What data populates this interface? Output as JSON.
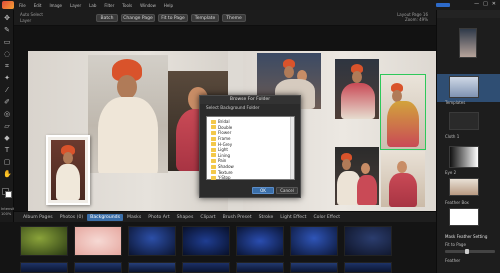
{
  "menubar": {
    "items": [
      "File",
      "Edit",
      "Image",
      "Layer",
      "Lab",
      "Filter",
      "Tools",
      "Window",
      "Help"
    ],
    "right_controls": [
      "—",
      "□",
      "✕"
    ]
  },
  "toolbar": {
    "buttons": [
      "Batch",
      "Change Page",
      "Fit to Page",
      "Template",
      "Theme"
    ],
    "info_line1": "Layout Page 16",
    "info_line2": "Zoom: 49%",
    "small_labels": [
      "Auto Select",
      "Layer"
    ]
  },
  "toolstrip": {
    "intensity_label": "Intensity",
    "intensity_value": "100%"
  },
  "dialog": {
    "title": "Browse For Folder",
    "subtitle": "Select Background Folder",
    "folders": [
      "Bridal",
      "Double",
      "Flower",
      "Frame",
      "H-Grey",
      "Light",
      "Lining",
      "Pain",
      "Shadow",
      "Texture",
      "Y-Stop"
    ],
    "ok_label": "OK",
    "cancel_label": "Cancel"
  },
  "bottomtabs": {
    "tabs": [
      "Album Pages",
      "Photos (0)",
      "Backgrounds",
      "Masks",
      "Photo Art",
      "Shapes",
      "Clipart",
      "Brush Preset",
      "Stroke",
      "Light Effect",
      "Color Effect"
    ],
    "active": "Backgrounds"
  },
  "rightpanel": {
    "labels": [
      "Templates",
      "Cloth 1",
      "Eye 2",
      "Feather Box",
      "Mask Feather Setting",
      "Fit to Page",
      "Feather"
    ],
    "selected": "Templates"
  },
  "colors": {
    "accent": "#3a6ea8",
    "selection": "#2f4e73",
    "turban": "#d9532b",
    "folder": "#f3c84a"
  }
}
